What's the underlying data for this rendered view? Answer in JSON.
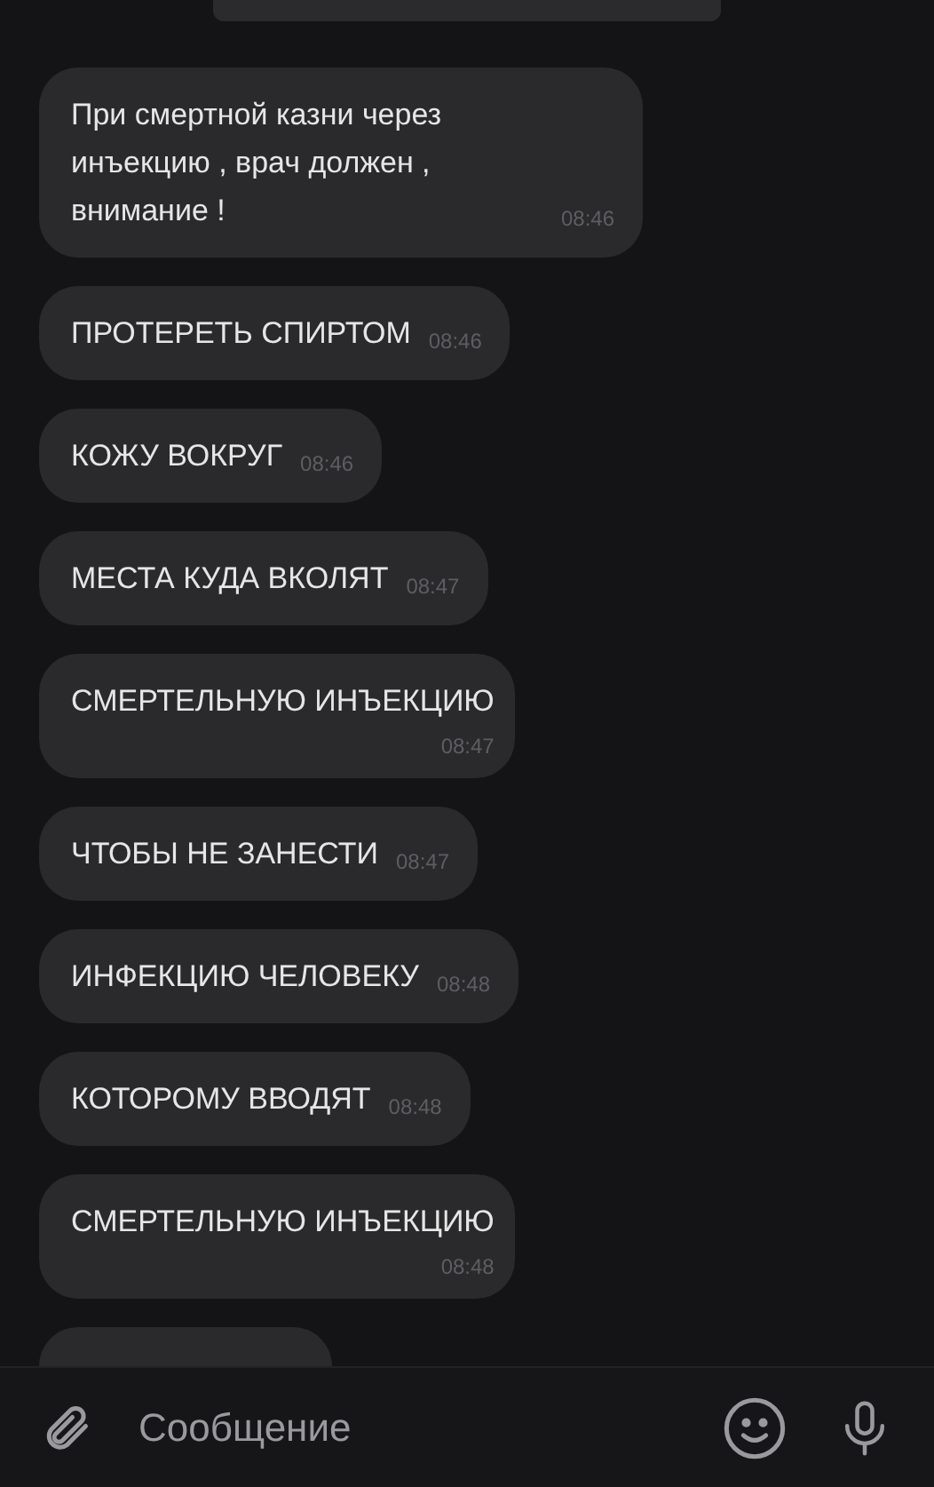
{
  "messages": [
    {
      "text": "При смертной казни через инъекцию , врач должен , внимание !",
      "time": "08:46",
      "kind": "inline"
    },
    {
      "text": "ПРОТЕРЕТЬ СПИРТОМ",
      "time": "08:46",
      "kind": "inline"
    },
    {
      "text": "КОЖУ ВОКРУГ",
      "time": "08:46",
      "kind": "inline"
    },
    {
      "text": "МЕСТА КУДА ВКОЛЯТ",
      "time": "08:47",
      "kind": "inline"
    },
    {
      "text": "СМЕРТЕЛЬНУЮ ИНЪЕКЦИЮ",
      "time": "08:47",
      "kind": "stacked"
    },
    {
      "text": "ЧТОБЫ НЕ ЗАНЕСТИ",
      "time": "08:47",
      "kind": "inline"
    },
    {
      "text": "ИНФЕКЦИЮ ЧЕЛОВЕКУ",
      "time": "08:48",
      "kind": "inline"
    },
    {
      "text": "КОТОРОМУ ВВОДЯТ",
      "time": "08:48",
      "kind": "inline"
    },
    {
      "text": "СМЕРТЕЛЬНУЮ ИНЪЕКЦИЮ",
      "time": "08:48",
      "kind": "stacked"
    },
    {
      "kind": "hidden"
    }
  ],
  "composer": {
    "placeholder": "Сообщение"
  }
}
